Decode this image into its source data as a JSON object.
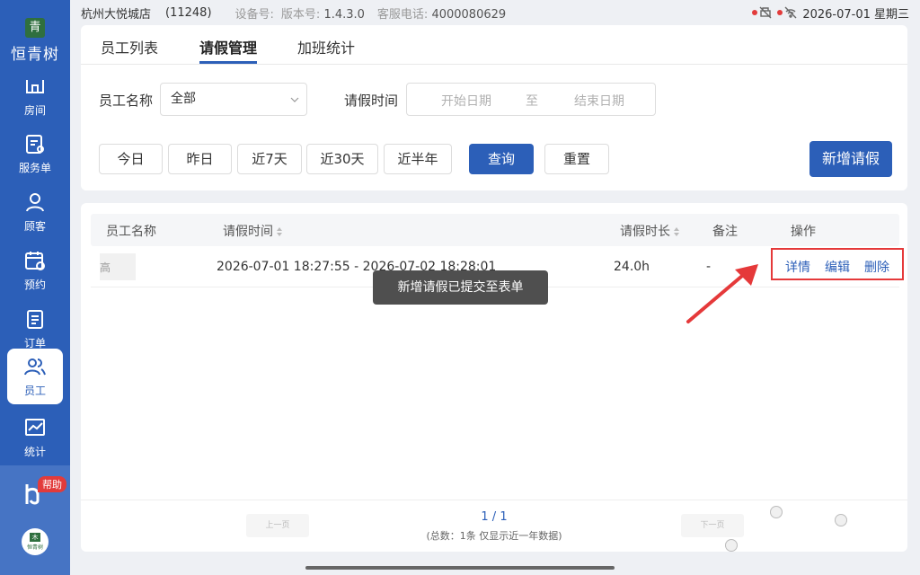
{
  "app": {
    "logo_char": "青",
    "logo_text": "恒青树",
    "avatar_char": "木",
    "avatar_text": "恒青树"
  },
  "sidebar": {
    "items": [
      {
        "label": "房间",
        "icon": "room-icon"
      },
      {
        "label": "服务单",
        "icon": "service-order-icon"
      },
      {
        "label": "顾客",
        "icon": "customer-icon"
      },
      {
        "label": "预约",
        "icon": "calendar-icon"
      },
      {
        "label": "订单",
        "icon": "order-icon"
      },
      {
        "label": "员工",
        "icon": "staff-icon",
        "active": true
      },
      {
        "label": "统计",
        "icon": "chart-icon"
      }
    ],
    "help_badge": "帮助"
  },
  "statusbar": {
    "store": "杭州大悦城店",
    "code": "(11248)",
    "device_label": "设备号:",
    "version_label": "版本号:",
    "version": "1.4.3.0",
    "service_label": "客服电话:",
    "service_phone": "4000080629",
    "datetime": "2026-07-01 星期三"
  },
  "tabs": [
    "员工列表",
    "请假管理",
    "加班统计"
  ],
  "filters": {
    "name_label": "员工名称",
    "name_value": "全部",
    "time_label": "请假时间",
    "start_placeholder": "开始日期",
    "to": "至",
    "end_placeholder": "结束日期"
  },
  "quick_buttons": [
    "今日",
    "昨日",
    "近7天",
    "近30天",
    "近半年"
  ],
  "query_button": "查询",
  "reset_button": "重置",
  "add_button": "新增请假",
  "table": {
    "headers": {
      "name": "员工名称",
      "time": "请假时间",
      "duration": "请假时长",
      "remark": "备注",
      "ops": "操作"
    },
    "rows": [
      {
        "name": "高",
        "time": "2026-07-01 18:27:55 - 2026-07-02 18:28:01",
        "duration": "24.0h",
        "remark": "-"
      }
    ],
    "ops": {
      "detail": "详情",
      "edit": "编辑",
      "delete": "删除"
    }
  },
  "toast": "新增请假已提交至表单",
  "pagination": {
    "prev": "上一页",
    "next": "下一页",
    "page": "1 / 1",
    "summary": "(总数：1条 仅显示近一年数据)"
  },
  "colors": {
    "primary": "#2c5fb8",
    "highlight": "#e5393a",
    "help_badge": "#e23b3b"
  }
}
